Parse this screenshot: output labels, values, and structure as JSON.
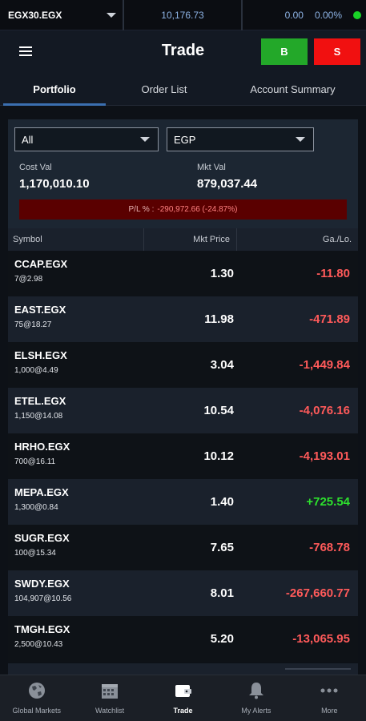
{
  "ticker": {
    "symbol": "EGX30.EGX",
    "price": "10,176.73",
    "change": "0.00",
    "change_pct": "0.00%"
  },
  "header": {
    "title": "Trade",
    "buy_label": "B",
    "sell_label": "S"
  },
  "tabs": [
    {
      "label": "Portfolio",
      "active": true
    },
    {
      "label": "Order List",
      "active": false
    },
    {
      "label": "Account Summary",
      "active": false
    }
  ],
  "summary": {
    "filter_value": "All",
    "currency_value": "EGP",
    "cost_label": "Cost Val",
    "cost_value": "1,170,010.10",
    "mkt_label": "Mkt Val",
    "mkt_value": "879,037.44",
    "pl_label": "P/L % :",
    "pl_value": "-290,972.66 (-24.87%)"
  },
  "table": {
    "headers": {
      "symbol": "Symbol",
      "mkt_price": "Mkt Price",
      "gain_loss": "Ga./Lo."
    },
    "rows": [
      {
        "symbol": "CCAP.EGX",
        "qty": "7@2.98",
        "mkt_price": "1.30",
        "gain_loss": "-11.80",
        "positive": false
      },
      {
        "symbol": "EAST.EGX",
        "qty": "75@18.27",
        "mkt_price": "11.98",
        "gain_loss": "-471.89",
        "positive": false
      },
      {
        "symbol": "ELSH.EGX",
        "qty": "1,000@4.49",
        "mkt_price": "3.04",
        "gain_loss": "-1,449.84",
        "positive": false
      },
      {
        "symbol": "ETEL.EGX",
        "qty": "1,150@14.08",
        "mkt_price": "10.54",
        "gain_loss": "-4,076.16",
        "positive": false
      },
      {
        "symbol": "HRHO.EGX",
        "qty": "700@16.11",
        "mkt_price": "10.12",
        "gain_loss": "-4,193.01",
        "positive": false
      },
      {
        "symbol": "MEPA.EGX",
        "qty": "1,300@0.84",
        "mkt_price": "1.40",
        "gain_loss": "+725.54",
        "positive": true
      },
      {
        "symbol": "SUGR.EGX",
        "qty": "100@15.34",
        "mkt_price": "7.65",
        "gain_loss": "-768.78",
        "positive": false
      },
      {
        "symbol": "SWDY.EGX",
        "qty": "104,907@10.56",
        "mkt_price": "8.01",
        "gain_loss": "-267,660.77",
        "positive": false
      },
      {
        "symbol": "TMGH.EGX",
        "qty": "2,500@10.43",
        "mkt_price": "5.20",
        "gain_loss": "-13,065.95",
        "positive": false
      }
    ]
  },
  "nav": [
    {
      "label": "Global Markets",
      "icon": "globe-icon",
      "active": false
    },
    {
      "label": "Watchlist",
      "icon": "calendar-grid-icon",
      "active": false
    },
    {
      "label": "Trade",
      "icon": "wallet-icon",
      "active": true
    },
    {
      "label": "My Alerts",
      "icon": "bell-icon",
      "active": false
    },
    {
      "label": "More",
      "icon": "more-dots-icon",
      "active": false
    }
  ],
  "colors": {
    "buy": "#23a829",
    "sell": "#f11010",
    "positive": "#2de02d",
    "negative": "#ff5a5a",
    "accent": "#3b6fb0"
  }
}
